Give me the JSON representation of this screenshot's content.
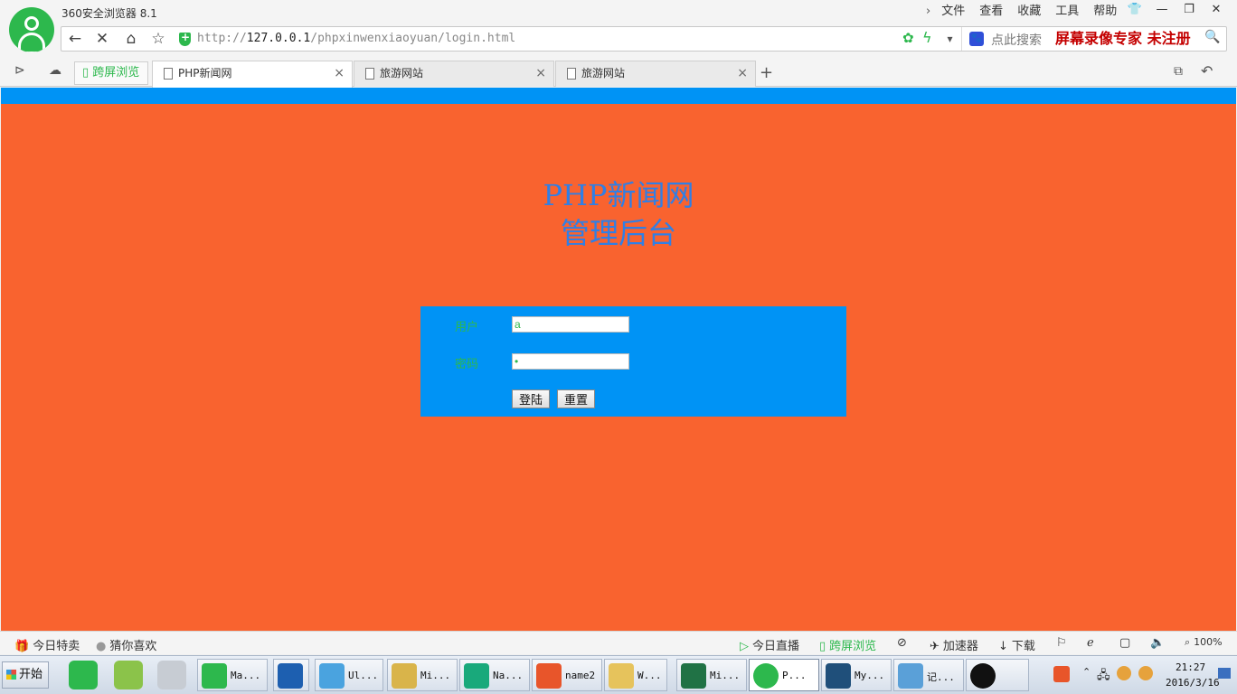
{
  "browser": {
    "app_title": "360安全浏览器 8.1",
    "menu": [
      "文件",
      "查看",
      "收藏",
      "工具",
      "帮助"
    ],
    "window_controls": [
      "minimize",
      "restore",
      "close"
    ],
    "address": {
      "url_prefix": "http://",
      "url_host": "127.0.0.1",
      "url_path": "/phpxinwenxiaoyuan/login.html",
      "search_placeholder": "点此搜索"
    },
    "recorder_label": "屏幕录像专家  未注册",
    "cross_screen_label": "跨屏浏览",
    "tabs": [
      {
        "label": "PHP新闻网",
        "active": true
      },
      {
        "label": "旅游网站",
        "active": false
      },
      {
        "label": "旅游网站",
        "active": false
      }
    ]
  },
  "page": {
    "colors": {
      "background": "#f9632f",
      "accent_bar": "#0093f5",
      "title": "#2f7fe6",
      "label": "#2db84d"
    },
    "title_line1": "PHP新闻网",
    "title_line2": "管理后台",
    "form": {
      "username_label": "用户",
      "username_value": "a",
      "password_label": "密码",
      "password_value": "•",
      "login_button": "登陆",
      "reset_button": "重置"
    }
  },
  "statusbar": {
    "left": [
      "今日特卖",
      "猜你喜欢"
    ],
    "right": [
      "今日直播",
      "跨屏浏览",
      "加速器",
      "下载"
    ],
    "zoom": "100%"
  },
  "taskbar": {
    "start_label": "开始",
    "tasks": [
      {
        "label": "Ma...",
        "color": "#2db84d"
      },
      {
        "label": "",
        "color": "#1d5fb0"
      },
      {
        "label": "Ul...",
        "color": "#4aa3df"
      },
      {
        "label": "Mi...",
        "color": "#d9b44a"
      },
      {
        "label": "Na...",
        "color": "#19a97b"
      },
      {
        "label": "name2",
        "color": "#e8552a"
      },
      {
        "label": "W...",
        "color": "#e6c35c"
      },
      {
        "label": "Mi...",
        "color": "#207245"
      },
      {
        "label": "P...",
        "color": "#2db84d"
      },
      {
        "label": "My...",
        "color": "#1f4f7a"
      },
      {
        "label": "记...",
        "color": "#5aa0d8"
      },
      {
        "label": "",
        "color": "#111111"
      }
    ],
    "clock_time": "21:27",
    "clock_date": "2016/3/16"
  }
}
